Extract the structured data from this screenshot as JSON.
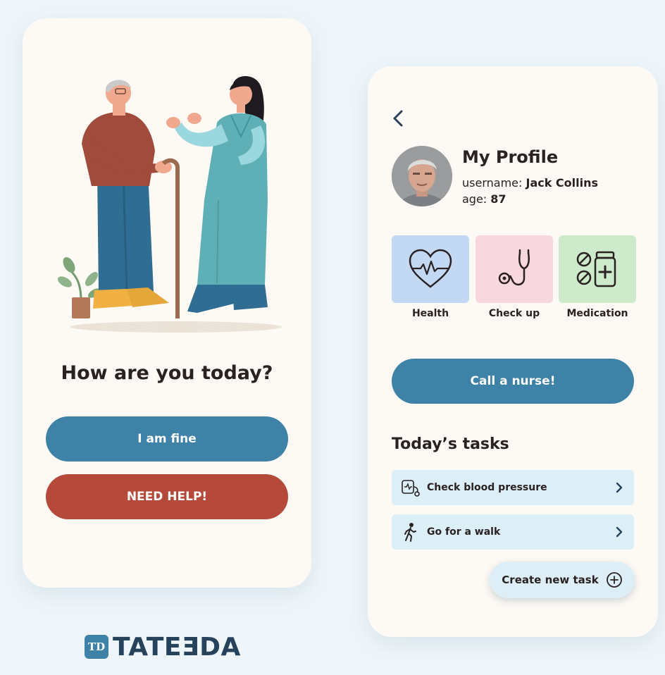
{
  "welcome_screen": {
    "greeting": "How are you today?",
    "fine_button": "I am fine",
    "help_button": "NEED HELP!"
  },
  "profile_screen": {
    "back_icon": "chevron-left-icon",
    "title": "My Profile",
    "username_label": "username:",
    "username_value": "Jack Collins",
    "age_label": "age:",
    "age_value": "87",
    "tiles": [
      {
        "label": "Health",
        "icon": "heart-pulse-icon",
        "color": "#c3d8f3"
      },
      {
        "label": "Check up",
        "icon": "stethoscope-icon",
        "color": "#f6d8de"
      },
      {
        "label": "Medication",
        "icon": "pills-icon",
        "color": "#cdeacb"
      }
    ],
    "call_button": "Call a nurse!",
    "tasks_title": "Today’s tasks",
    "tasks": [
      {
        "label": "Check blood pressure",
        "icon": "blood-pressure-icon"
      },
      {
        "label": "Go for a walk",
        "icon": "walking-icon"
      }
    ],
    "create_task": "Create new task"
  },
  "brand": {
    "mark": "TD",
    "name": "TATEƎDA"
  },
  "colors": {
    "primary": "#3f82a8",
    "danger": "#b5493a",
    "background": "#eef6fa",
    "card": "#fdf9f4"
  }
}
